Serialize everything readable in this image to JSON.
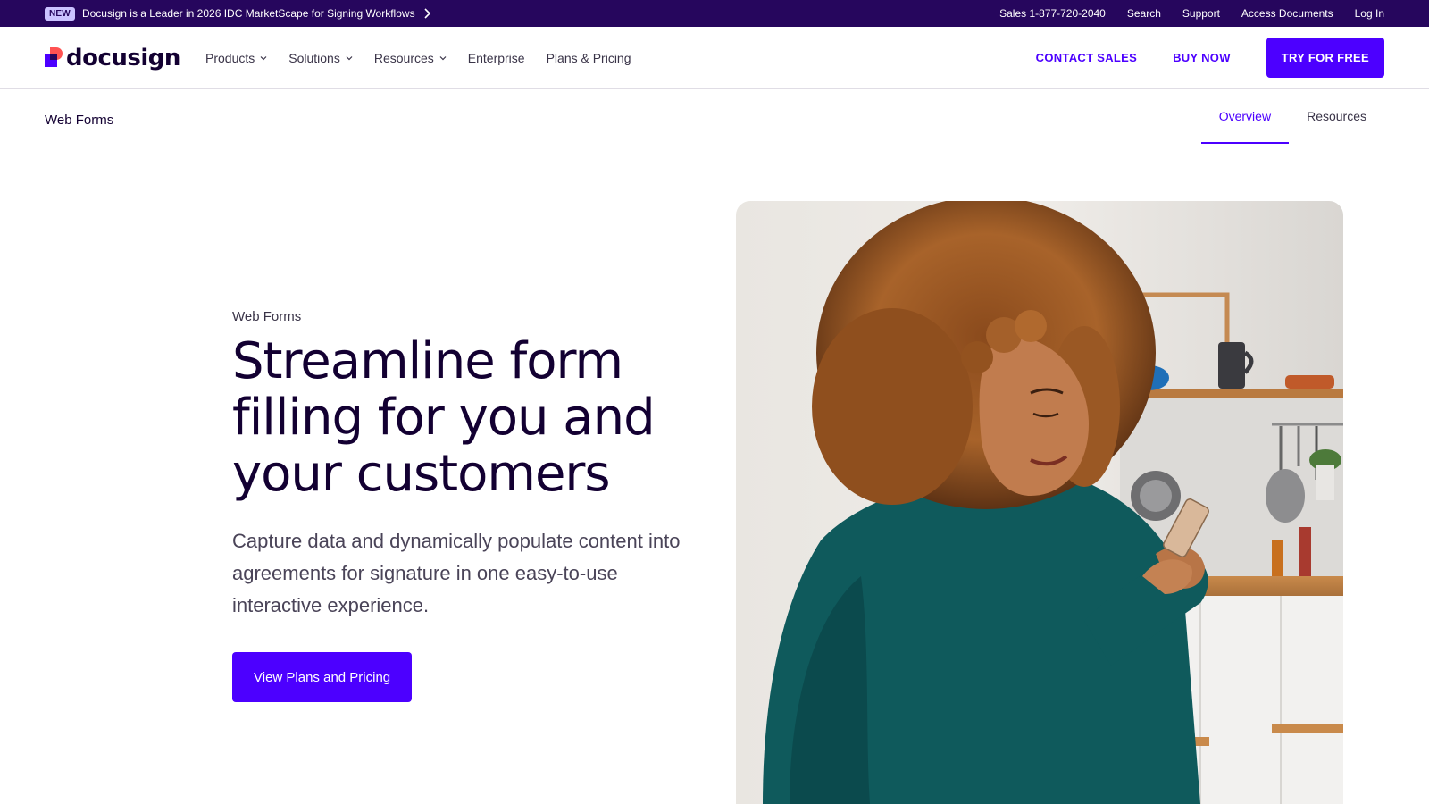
{
  "topbar": {
    "badge": "NEW",
    "promo": "Docusign is a Leader in 2026 IDC MarketScape for Signing Workflows",
    "sales": "Sales 1-877-720-2040",
    "search": "Search",
    "support": "Support",
    "access_documents": "Access Documents",
    "login": "Log In",
    "background_color": "#26065d"
  },
  "nav": {
    "logo_text": "docusign",
    "links": [
      {
        "label": "Products",
        "has_dropdown": true
      },
      {
        "label": "Solutions",
        "has_dropdown": true
      },
      {
        "label": "Resources",
        "has_dropdown": true
      },
      {
        "label": "Enterprise",
        "has_dropdown": false
      },
      {
        "label": "Plans & Pricing",
        "has_dropdown": false
      }
    ],
    "contact_sales": "CONTACT SALES",
    "buy_now": "BUY NOW",
    "try_free": "TRY FOR FREE",
    "accent_color": "#4c00ff"
  },
  "subnav": {
    "title": "Web Forms",
    "tabs": [
      {
        "label": "Overview",
        "active": true
      },
      {
        "label": "Resources",
        "active": false
      }
    ]
  },
  "hero": {
    "eyebrow": "Web Forms",
    "headline_lines": [
      "Streamline form",
      "filling for you and",
      "your customers"
    ],
    "subcopy": "Capture data and dynamically populate content into agreements for signature in one easy-to-use interactive experience.",
    "cta": "View Plans and Pricing",
    "image_icon": "hero-photo-woman-with-phone"
  }
}
